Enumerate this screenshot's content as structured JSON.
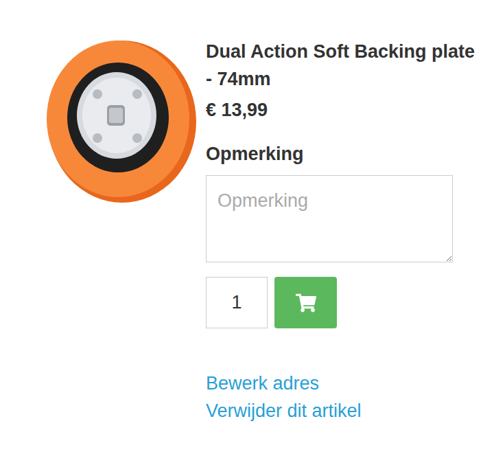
{
  "product": {
    "title": "Dual Action Soft Backing plate - 74mm",
    "price": "€ 13,99"
  },
  "remark": {
    "label": "Opmerking",
    "placeholder": "Opmerking"
  },
  "quantity": "1",
  "links": [
    "Bewerk adres",
    "Verwijder dit artikel"
  ]
}
